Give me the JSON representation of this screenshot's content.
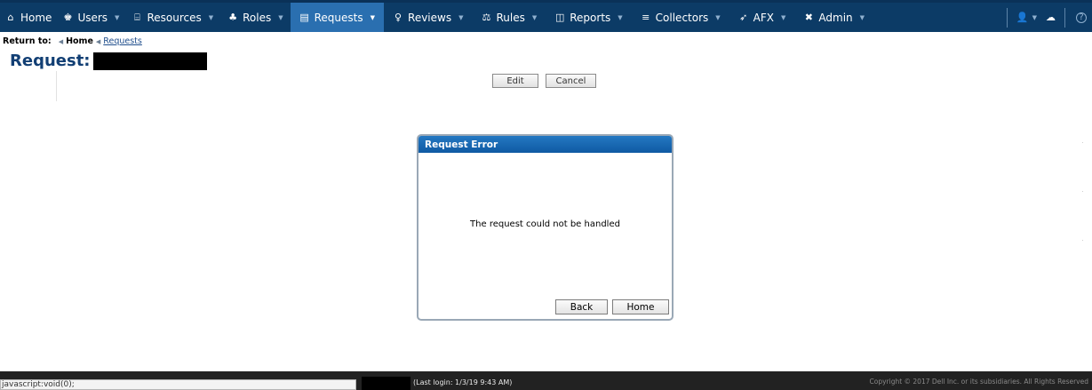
{
  "nav": {
    "items": [
      {
        "label": "Home",
        "icon": "home-icon",
        "glyph": "⌂",
        "caret": false,
        "active": false
      },
      {
        "label": "Users",
        "icon": "users-icon",
        "glyph": "♚",
        "caret": true,
        "active": false
      },
      {
        "label": "Resources",
        "icon": "bank-icon",
        "glyph": "⌸",
        "caret": true,
        "active": false
      },
      {
        "label": "Roles",
        "icon": "hierarchy-icon",
        "glyph": "♣",
        "caret": true,
        "active": false
      },
      {
        "label": "Requests",
        "icon": "clipboard-icon",
        "glyph": "▤",
        "caret": true,
        "active": true
      },
      {
        "label": "Reviews",
        "icon": "pin-icon",
        "glyph": "♀",
        "caret": true,
        "active": false
      },
      {
        "label": "Rules",
        "icon": "scale-icon",
        "glyph": "⚖",
        "caret": true,
        "active": false
      },
      {
        "label": "Reports",
        "icon": "chart-icon",
        "glyph": "◫",
        "caret": true,
        "active": false
      },
      {
        "label": "Collectors",
        "icon": "database-icon",
        "glyph": "≡",
        "caret": true,
        "active": false
      },
      {
        "label": "AFX",
        "icon": "rocket-icon",
        "glyph": "➶",
        "caret": true,
        "active": false
      },
      {
        "label": "Admin",
        "icon": "tools-icon",
        "glyph": "✖",
        "caret": true,
        "active": false
      }
    ],
    "right": {
      "user_icon": "user-icon",
      "cloud_icon": "cloud-icon",
      "help_icon": "help-icon"
    }
  },
  "breadcrumb": {
    "return_label": "Return to:",
    "home": "Home",
    "current": "Requests"
  },
  "page": {
    "title": "Request:"
  },
  "toolbar": {
    "edit_label": "Edit",
    "cancel_label": "Cancel"
  },
  "dialog": {
    "title": "Request Error",
    "message": "The request could not be handled",
    "back_label": "Back",
    "home_label": "Home"
  },
  "footer": {
    "status_url": "javascript:void(0);",
    "last_login": "(Last login: 1/3/19 9:43 AM)",
    "copyright": "Copyright © 2017 Dell Inc. or its subsidiaries. All Rights Reserved"
  },
  "colors": {
    "nav_bg": "#0c3b66",
    "nav_active": "#2a6fb0",
    "title": "#123f74",
    "dialog_header": "#1a69b5"
  }
}
